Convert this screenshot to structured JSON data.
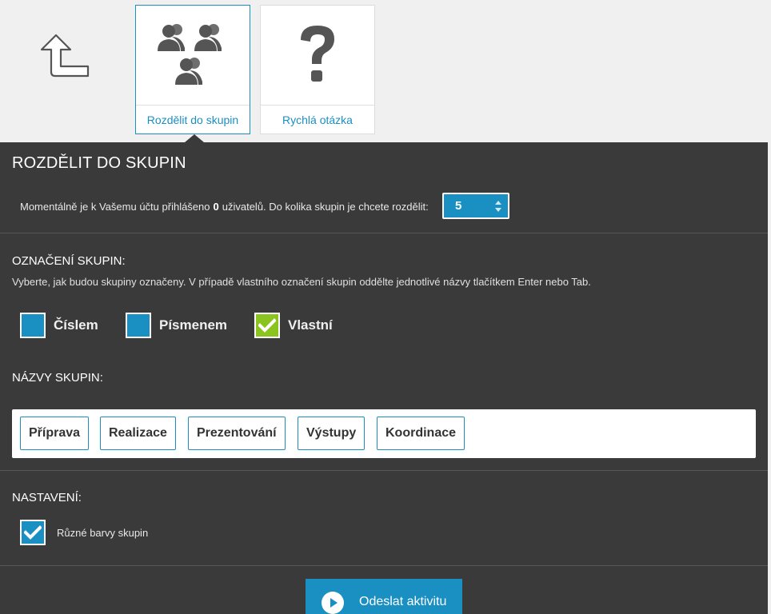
{
  "tiles": [
    {
      "label": "Rozdělit do skupin",
      "icon": "groups-icon",
      "active": true
    },
    {
      "label": "Rychlá otázka",
      "icon": "question-icon",
      "active": false
    }
  ],
  "panel": {
    "title": "ROZDĚLIT DO SKUPIN",
    "info_prefix": "Momentálně je k Vašemu účtu přihlášeno",
    "info_count": "0",
    "info_suffix": "uživatelů. Do kolika skupin je chcete rozdělit:",
    "group_count": "5"
  },
  "labeling": {
    "heading": "OZNAČENÍ SKUPIN:",
    "description": "Vyberte, jak budou skupiny označeny. V případě vlastního označení skupin oddělte jednotlivé názvy tlačítkem Enter nebo Tab.",
    "options": [
      {
        "label": "Číslem",
        "checked": false
      },
      {
        "label": "Písmenem",
        "checked": false
      },
      {
        "label": "Vlastní",
        "checked": true
      }
    ]
  },
  "names": {
    "heading": "NÁZVY SKUPIN:",
    "items": [
      "Příprava",
      "Realizace",
      "Prezentování",
      "Výstupy",
      "Koordinace"
    ]
  },
  "settings": {
    "heading": "NASTAVENÍ:",
    "different_colors_label": "Různé barvy skupin",
    "different_colors_checked": true
  },
  "submit": {
    "label": "Odeslat aktivitu"
  },
  "colors": {
    "accent": "#1a8fc2",
    "panel": "#3a3a3a",
    "check_green": "#8bc31f",
    "background": "#f0f0f0"
  }
}
